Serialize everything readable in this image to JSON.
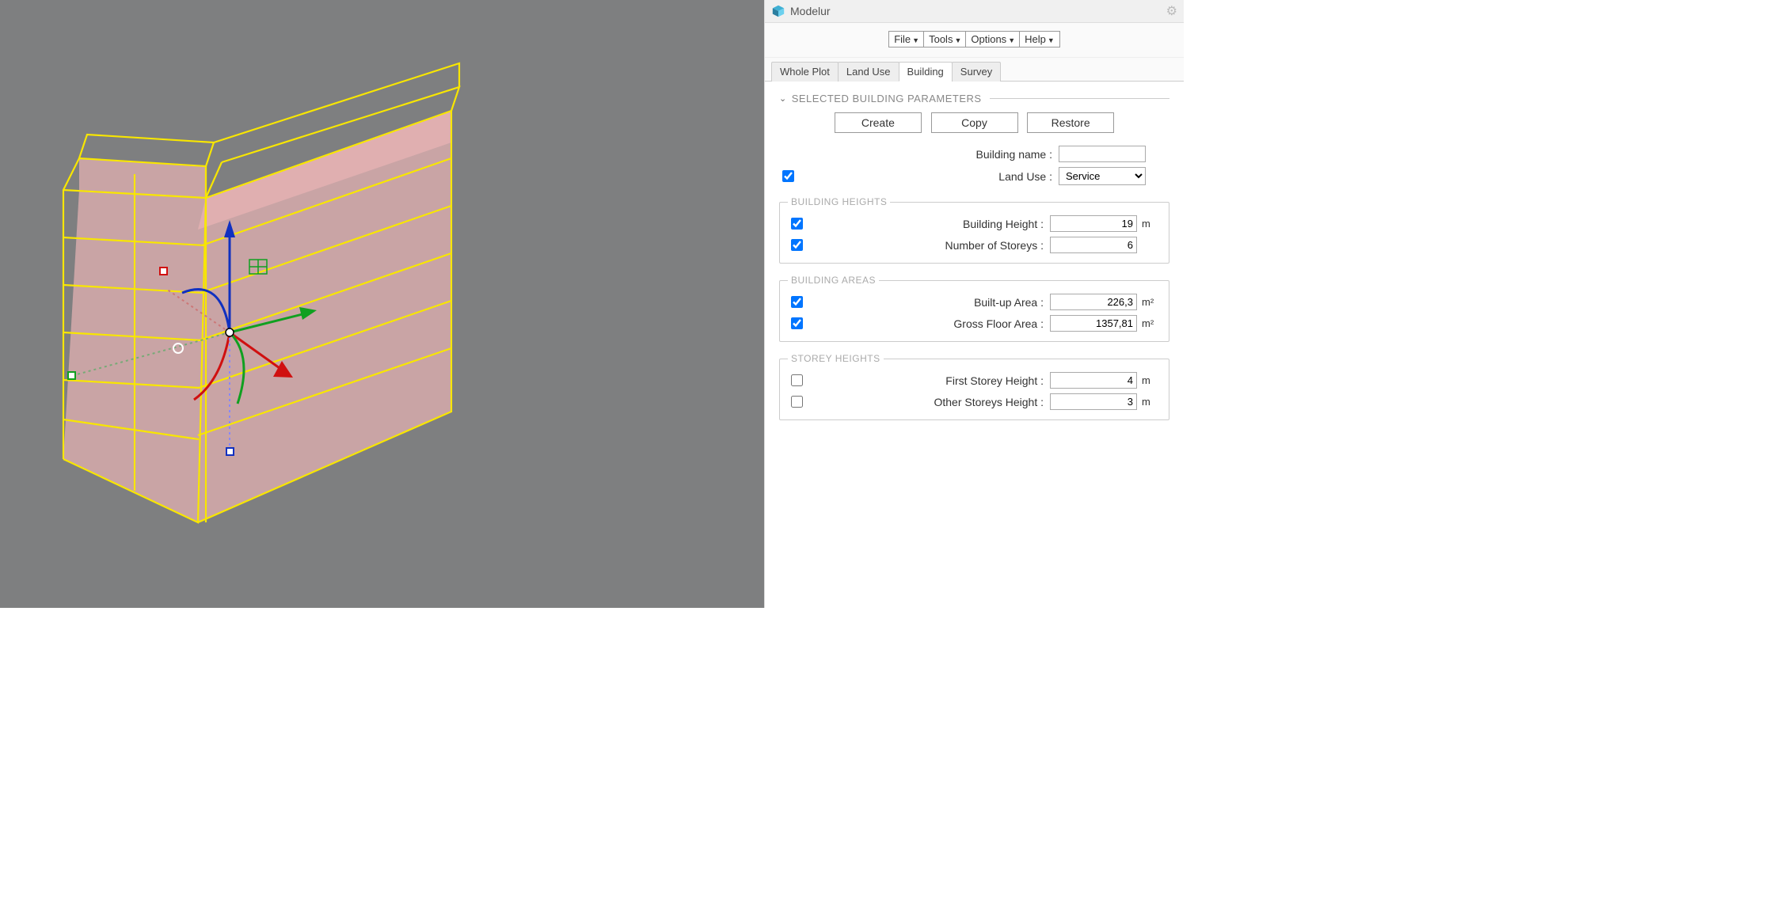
{
  "app": {
    "title": "Modelur"
  },
  "menus": {
    "file": "File",
    "tools": "Tools",
    "options": "Options",
    "help": "Help"
  },
  "tabs": {
    "wholePlot": "Whole Plot",
    "landUse": "Land Use",
    "building": "Building",
    "survey": "Survey",
    "active": "building"
  },
  "section": {
    "title": "Selected Building Parameters",
    "chev": "⋁"
  },
  "actions": {
    "create": "Create",
    "copy": "Copy",
    "restore": "Restore"
  },
  "fields": {
    "buildingName": {
      "label": "Building name :",
      "value": ""
    },
    "landUse": {
      "label": "Land Use :",
      "value": "Service",
      "checked": true
    }
  },
  "groups": {
    "heights": {
      "legend": "Building Heights",
      "buildingHeight": {
        "label": "Building Height :",
        "value": "19",
        "unit": "m",
        "checked": true
      },
      "storeys": {
        "label": "Number of Storeys :",
        "value": "6",
        "unit": "",
        "checked": true
      }
    },
    "areas": {
      "legend": "Building Areas",
      "builtUp": {
        "label": "Built-up Area :",
        "value": "226,3",
        "unit": "m²",
        "checked": true
      },
      "gross": {
        "label": "Gross Floor Area :",
        "value": "1357,81",
        "unit": "m²",
        "checked": true
      }
    },
    "storeyHeights": {
      "legend": "Storey Heights",
      "first": {
        "label": "First Storey Height :",
        "value": "4",
        "unit": "m",
        "checked": false
      },
      "other": {
        "label": "Other Storeys Height :",
        "value": "3",
        "unit": "m",
        "checked": false
      }
    }
  }
}
